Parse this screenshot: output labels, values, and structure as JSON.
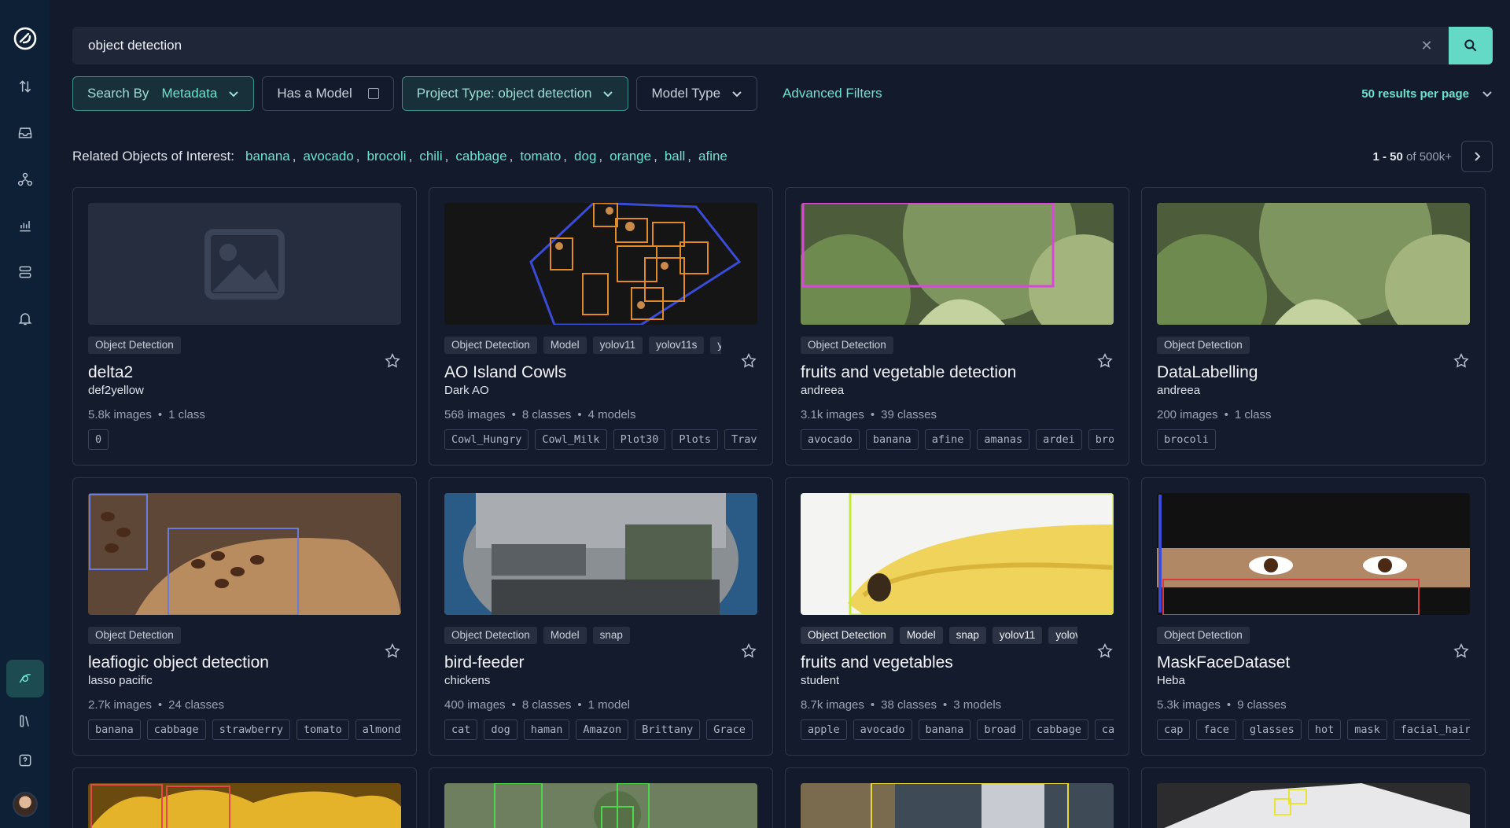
{
  "search": {
    "query": "object detection",
    "clear_icon": "close-icon",
    "button_icon": "search-icon"
  },
  "filters": {
    "search_by_label": "Search By",
    "search_by_value": "Metadata",
    "has_model_label": "Has a Model",
    "project_type_label": "Project Type: object detection",
    "model_type_label": "Model Type",
    "advanced_label": "Advanced Filters",
    "per_page_label": "50 results per page"
  },
  "related": {
    "label": "Related Objects of Interest:",
    "objects": [
      "banana",
      "avocado",
      "brocoli",
      "chili",
      "cabbage",
      "tomato",
      "dog",
      "orange",
      "ball",
      "afine"
    ]
  },
  "pagination": {
    "range": "1 - 50",
    "total": "of 500k+"
  },
  "colors": {
    "accent": "#6be3cf",
    "background": "#131a2b",
    "sidebar": "#0e2035"
  },
  "cards": [
    {
      "tags": [
        "Object Detection"
      ],
      "title": "delta2",
      "owner": "def2yellow",
      "stats": [
        "5.8k images",
        "1 class"
      ],
      "classes": [
        "0"
      ]
    },
    {
      "tags": [
        "Object Detection",
        "Model",
        "yolov11",
        "yolov11s",
        "yt"
      ],
      "title": "AO Island Cowls",
      "owner": "Dark AO",
      "stats": [
        "568 images",
        "8 classes",
        "4 models"
      ],
      "classes": [
        "Cowl_Hungry",
        "Cowl_Milk",
        "Plot30",
        "Plots",
        "Travi"
      ]
    },
    {
      "tags": [
        "Object Detection"
      ],
      "title": "fruits and vegetable detection",
      "owner": "andreea",
      "stats": [
        "3.1k images",
        "39 classes"
      ],
      "classes": [
        "avocado",
        "banana",
        "afine",
        "amanas",
        "ardei",
        "bro"
      ]
    },
    {
      "tags": [
        "Object Detection"
      ],
      "title": "DataLabelling",
      "owner": "andreea",
      "stats": [
        "200 images",
        "1 class"
      ],
      "classes": [
        "brocoli"
      ]
    },
    {
      "tags": [
        "Object Detection"
      ],
      "title": "leafiogic object detection",
      "owner": "lasso pacific",
      "stats": [
        "2.7k images",
        "24 classes"
      ],
      "classes": [
        "banana",
        "cabbage",
        "strawberry",
        "tomato",
        "almonds"
      ]
    },
    {
      "tags": [
        "Object Detection",
        "Model",
        "snap"
      ],
      "title": "bird-feeder",
      "owner": "chickens",
      "stats": [
        "400 images",
        "8 classes",
        "1 model"
      ],
      "classes": [
        "cat",
        "dog",
        "haman",
        "Amazon",
        "Brittany",
        "Grace"
      ]
    },
    {
      "tags": [
        "Object Detection",
        "Model",
        "snap",
        "yolov11",
        "yolov"
      ],
      "title": "fruits and vegetables",
      "owner": "student",
      "stats": [
        "8.7k images",
        "38 classes",
        "3 models"
      ],
      "classes": [
        "apple",
        "avocado",
        "banana",
        "broad",
        "cabbage",
        "ca"
      ]
    },
    {
      "tags": [
        "Object Detection"
      ],
      "title": "MaskFaceDataset",
      "owner": "Heba",
      "stats": [
        "5.3k images",
        "9 classes"
      ],
      "classes": [
        "cap",
        "face",
        "glasses",
        "hot",
        "mask",
        "facial_hair"
      ]
    }
  ]
}
